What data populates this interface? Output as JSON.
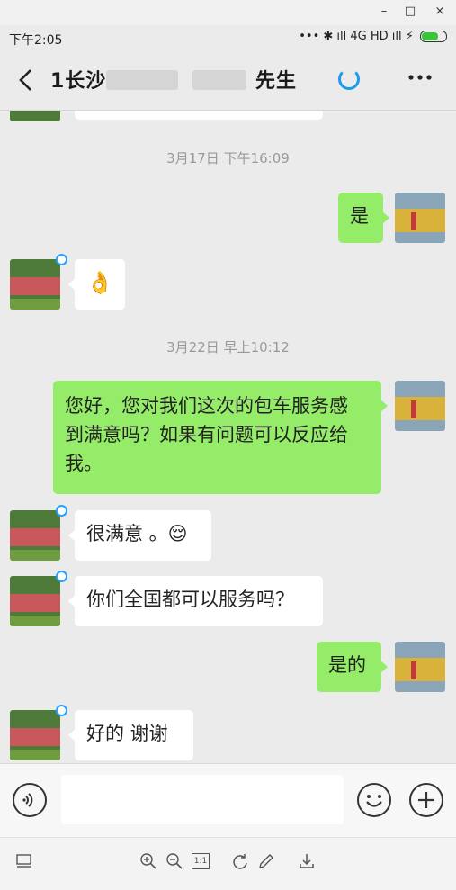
{
  "window": {
    "controls": [
      "–",
      "□",
      "×"
    ]
  },
  "status_bar": {
    "time": "下午2:05",
    "right_text": "•••  ✱  ıll 4G HD ıll ⚡"
  },
  "header": {
    "title": "1长沙",
    "title_suffix": "先生"
  },
  "messages": [
    {
      "type": "timestamp",
      "text": "3月17日 下午16:09"
    },
    {
      "type": "out",
      "text": "是"
    },
    {
      "type": "in",
      "text": "👌"
    },
    {
      "type": "timestamp",
      "text": "3月22日 早上10:12"
    },
    {
      "type": "out",
      "lines": [
        "您好，您对我们这次的包车服务感",
        "到满意吗？如果有问题可以反应给",
        "我。"
      ]
    },
    {
      "type": "in",
      "text": "很满意 。😌"
    },
    {
      "type": "in",
      "text": "你们全国都可以服务吗？"
    },
    {
      "type": "out",
      "text": "是的"
    },
    {
      "type": "in",
      "text": "好的 谢谢"
    }
  ],
  "colors": {
    "out_bubble": "#95ec69",
    "in_bubble": "#ffffff",
    "background": "#ebebeb",
    "accent": "#1b9be9"
  },
  "toolbar": {
    "icons": [
      "sidebar-icon",
      "zoom-in-icon",
      "zoom-out-icon",
      "actual-size-icon",
      "rotate-icon",
      "edit-icon",
      "download-icon"
    ],
    "actual_size_label": "1:1"
  }
}
